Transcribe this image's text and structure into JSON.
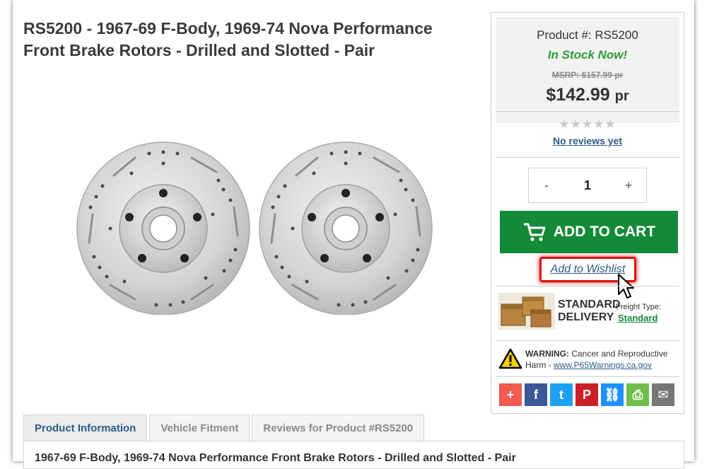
{
  "product": {
    "title": "RS5200 - 1967-69 F-Body, 1969-74 Nova Performance Front Brake Rotors - Drilled and Slotted - Pair",
    "image_icon": "brake-rotors-pair"
  },
  "purchase_panel": {
    "product_number": "Product #: RS5200",
    "stock_status": "In Stock Now!",
    "msrp": "MSRP: $157.99 pr",
    "price": "$142.99",
    "price_unit": "pr",
    "stars": "★★★★★",
    "rating_fraction": 0,
    "reviews_link": "No reviews yet",
    "quantity": {
      "decrement_label": "-",
      "value": "1",
      "increment_label": "+"
    },
    "add_to_cart_label": "ADD TO CART",
    "add_to_wishlist_label": "Add to Wishlist",
    "delivery": {
      "line1": "STANDARD",
      "line2": "DELIVERY",
      "freight_label": "Freight Type:",
      "freight_value": "Standard"
    },
    "warning": {
      "label": "WARNING:",
      "text": "Cancer and Reproductive Harm -",
      "link": "www.P65Warnings.ca.gov"
    },
    "share_buttons": [
      {
        "name": "addthis-more",
        "glyph": "+",
        "color": "#f15b50"
      },
      {
        "name": "facebook",
        "glyph": "f",
        "color": "#3b5998"
      },
      {
        "name": "twitter",
        "glyph": "t",
        "color": "#1da1f2"
      },
      {
        "name": "pinterest",
        "glyph": "P",
        "color": "#cb2027"
      },
      {
        "name": "copy-link",
        "glyph": "⛓",
        "color": "#1e90ff"
      },
      {
        "name": "print",
        "glyph": "⎙",
        "color": "#6fbf4a"
      },
      {
        "name": "email",
        "glyph": "✉",
        "color": "#777777"
      }
    ]
  },
  "tabs": [
    {
      "label": "Product Information",
      "active": true
    },
    {
      "label": "Vehicle Fitment",
      "active": false
    },
    {
      "label": "Reviews for Product #RS5200",
      "active": false
    }
  ],
  "tab_content": {
    "heading": "1967-69 F-Body, 1969-74 Nova Performance Front Brake Rotors - Drilled and Slotted - Pair"
  },
  "colors": {
    "accent_green": "#138a38",
    "in_stock_green": "#2e9a3a",
    "link_blue": "#2c5b8a",
    "highlight_red": "#e01010"
  }
}
